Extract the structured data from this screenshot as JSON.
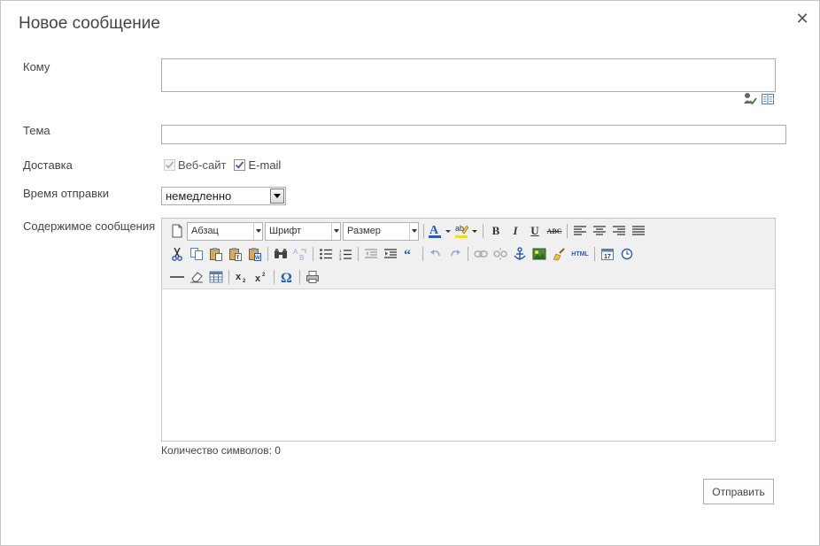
{
  "dialog": {
    "title": "Новое сообщение",
    "close_symbol": "✕"
  },
  "form": {
    "to_label": "Кому",
    "to_value": "",
    "subject_label": "Тема",
    "subject_value": "",
    "delivery_label": "Доставка",
    "delivery_options": [
      {
        "label": "Веб-сайт",
        "checked": true,
        "disabled": true
      },
      {
        "label": "E-mail",
        "checked": true,
        "disabled": false
      }
    ],
    "send_time_label": "Время отправки",
    "send_time_value": "немедленно",
    "content_label": "Содержимое сообщения"
  },
  "toolbar": {
    "paragraph_combo": "Абзац",
    "font_combo": "Шрифт",
    "size_combo": "Размер",
    "bold": "B",
    "italic": "I",
    "underline": "U",
    "strike": "ABC",
    "html": "HTML"
  },
  "footer": {
    "char_count": "Количество символов: 0",
    "send_button": "Отправить"
  },
  "colors": {
    "border": "#ababab",
    "toolbar_bg": "#f0f0f0",
    "text": "#444444",
    "accent_blue": "#2a5bb5"
  }
}
